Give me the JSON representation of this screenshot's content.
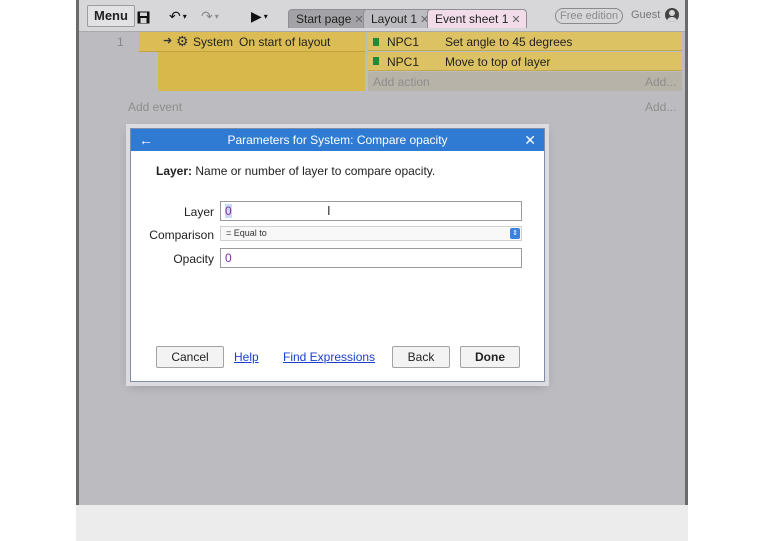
{
  "toolbar": {
    "menu_label": "Menu",
    "tabs": [
      {
        "label": "Start page"
      },
      {
        "label": "Layout 1"
      },
      {
        "label": "Event sheet 1"
      }
    ],
    "edition_badge": "Free edition",
    "user_label": "Guest"
  },
  "event_sheet": {
    "event_number": "1",
    "condition": {
      "object": "System",
      "text": "On start of layout"
    },
    "actions": [
      {
        "object": "NPC1",
        "text": "Set angle to 45 degrees"
      },
      {
        "object": "NPC1",
        "text": "Move to top of layer"
      }
    ],
    "add_action": "Add action",
    "add_right": "Add...",
    "add_event": "Add event"
  },
  "dialog": {
    "title": "Parameters for System: Compare opacity",
    "description_bold": "Layer:",
    "description_text": " Name or number of layer to compare opacity.",
    "params": {
      "layer_label": "Layer",
      "layer_value": "0",
      "comparison_label": "Comparison",
      "comparison_value": "= Equal to",
      "opacity_label": "Opacity",
      "opacity_value": "0"
    },
    "buttons": {
      "cancel": "Cancel",
      "help": "Help",
      "find_expressions": "Find Expressions",
      "back": "Back",
      "done": "Done"
    }
  },
  "colors": {
    "title_bar": "#2f7ad2",
    "condition": "#dcbd55",
    "action": "#dcc262"
  }
}
